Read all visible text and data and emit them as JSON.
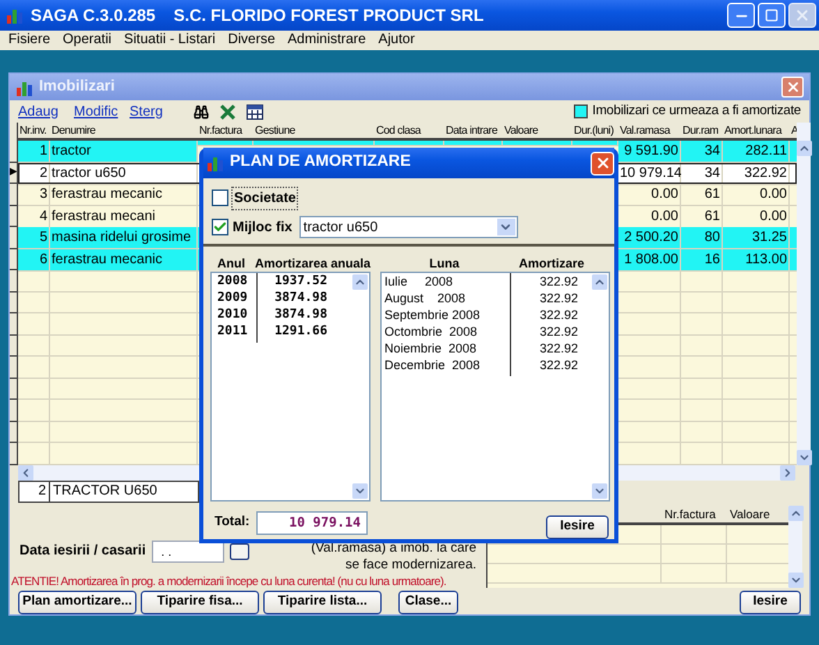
{
  "window": {
    "app": "SAGA C.3.0.285",
    "company": "S.C. FLORIDO FOREST PRODUCT SRL",
    "controls": [
      {
        "kind": "minimize",
        "disabled": false
      },
      {
        "kind": "maximize",
        "disabled": false
      },
      {
        "kind": "close",
        "disabled": true
      }
    ]
  },
  "menu": [
    "Fisiere",
    "Operatii",
    "Situatii - Listari",
    "Diverse",
    "Administrare",
    "Ajutor"
  ],
  "child": {
    "title": "Imobilizari",
    "toolbar": [
      "Adaug",
      "Modific",
      "Sterg"
    ],
    "legend": {
      "label": "Imobilizari ce urmeaza a fi amortizate",
      "color": "#22f4f4"
    }
  },
  "table": {
    "pointer": "▶",
    "columns": [
      "Nr.inv.",
      "Denumire",
      "Nr.factura",
      "Gestiune",
      "Cod clasa",
      "Data intrare",
      "Valoare",
      "Dur.(luni)",
      "Val.ramasa",
      "Dur.ram",
      "Amort.lunara",
      "A"
    ],
    "rows": [
      {
        "nr": "1",
        "name": "tractor",
        "val_ramasa": "9 591.90",
        "dur_ram": "34",
        "amort_lunara": "282.11",
        "highlight": true,
        "selected": false
      },
      {
        "nr": "2",
        "name": "tractor u650",
        "val_ramasa": "10 979.14",
        "dur_ram": "34",
        "amort_lunara": "322.92",
        "highlight": false,
        "selected": true
      },
      {
        "nr": "3",
        "name": "ferastrau mecanic",
        "val_ramasa": "0.00",
        "dur_ram": "61",
        "amort_lunara": "0.00",
        "highlight": false,
        "selected": false
      },
      {
        "nr": "4",
        "name": "ferastrau mecani",
        "val_ramasa": "0.00",
        "dur_ram": "61",
        "amort_lunara": "0.00",
        "highlight": false,
        "selected": false
      },
      {
        "nr": "5",
        "name": "masina ridelui grosime",
        "val_ramasa": "2 500.20",
        "dur_ram": "80",
        "amort_lunara": "31.25",
        "highlight": true,
        "selected": false
      },
      {
        "nr": "6",
        "name": "ferastrau mecanic",
        "val_ramasa": "1 808.00",
        "dur_ram": "16",
        "amort_lunara": "113.00",
        "highlight": true,
        "selected": false
      }
    ]
  },
  "detail": {
    "nr": "2",
    "name": "TRACTOR U650"
  },
  "exit_date": {
    "label": "Data iesirii / casarii",
    "value": ". ."
  },
  "notes": [
    "(Val.ramasa) a imob. la care",
    "se face modernizarea."
  ],
  "warning": "ATENTIE! Amortizarea în prog. a modernizarii începe cu luna curenta! (nu cu luna urmatoare).",
  "lower_table": {
    "columns": [
      "Nr.factura",
      "Valoare"
    ]
  },
  "buttons": [
    "Plan amortizare...",
    "Tiparire fisa...",
    "Tiparire lista...",
    "Clase..."
  ],
  "exit_button": "Iesire",
  "dialog": {
    "title": "PLAN DE AMORTIZARE",
    "societate": {
      "label": "Societate",
      "checked": false
    },
    "mijloc_fix": {
      "label": "Mijloc fix",
      "checked": true,
      "value": "tractor u650"
    },
    "annual_headers": [
      "Anul",
      "Amortizarea anuala"
    ],
    "annual": [
      {
        "year": "2008",
        "amount": "1937.52"
      },
      {
        "year": "2009",
        "amount": "3874.98"
      },
      {
        "year": "2010",
        "amount": "3874.98"
      },
      {
        "year": "2011",
        "amount": "1291.66"
      }
    ],
    "monthly_headers": [
      "Luna",
      "Amortizare"
    ],
    "monthly": [
      {
        "month": "Iulie     2008",
        "amount": "322.92"
      },
      {
        "month": "August    2008",
        "amount": "322.92"
      },
      {
        "month": "Septembrie 2008",
        "amount": "322.92"
      },
      {
        "month": "Octombrie  2008",
        "amount": "322.92"
      },
      {
        "month": "Noiembrie  2008",
        "amount": "322.92"
      },
      {
        "month": "Decembrie  2008",
        "amount": "322.92"
      }
    ],
    "total_label": "Total:",
    "total": "10 979.14",
    "exit": "Iesire"
  }
}
